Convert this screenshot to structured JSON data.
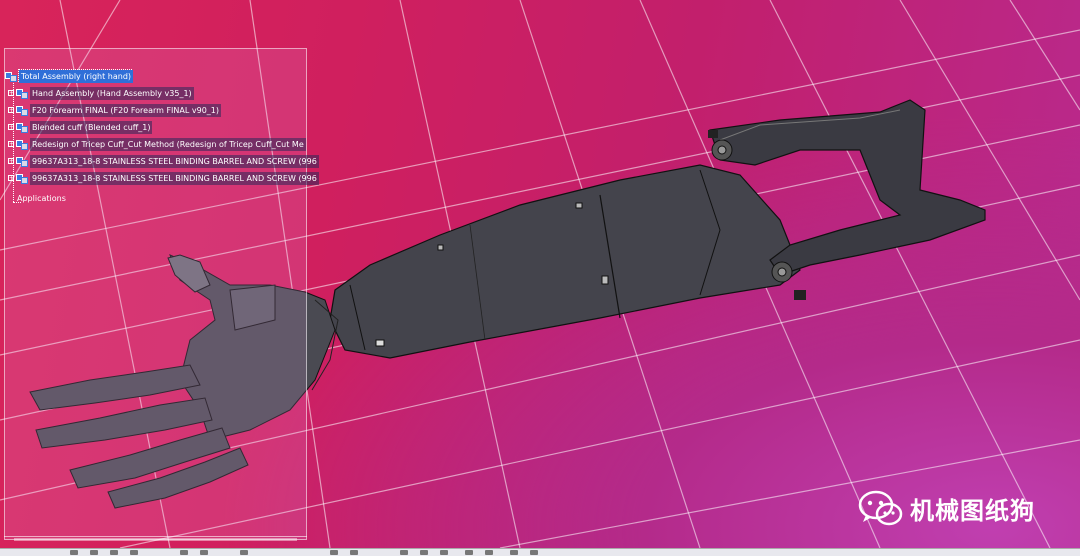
{
  "tree": {
    "root": "Total Assembly (right hand)",
    "items": [
      "Hand Assembly (Hand Assembly v35_1)",
      "F20 Forearm FINAL (F20 Forearm FINAL v90_1)",
      "Blended cuff (Blended cuff_1)",
      "Redesign of Tricep Cuff_Cut Method (Redesign of Tricep Cuff_Cut Me",
      "99637A313_18-8 STAINLESS STEEL BINDING BARREL AND SCREW (996",
      "99637A313_18-8 STAINLESS STEEL BINDING BARREL AND SCREW (996"
    ],
    "applications": "Applications"
  },
  "watermark": {
    "text": "机械图纸狗",
    "icon": "wechat-icon"
  },
  "colors": {
    "background": "#d0205f",
    "selection": "#2f6fd8",
    "model": "#3a3a42"
  }
}
